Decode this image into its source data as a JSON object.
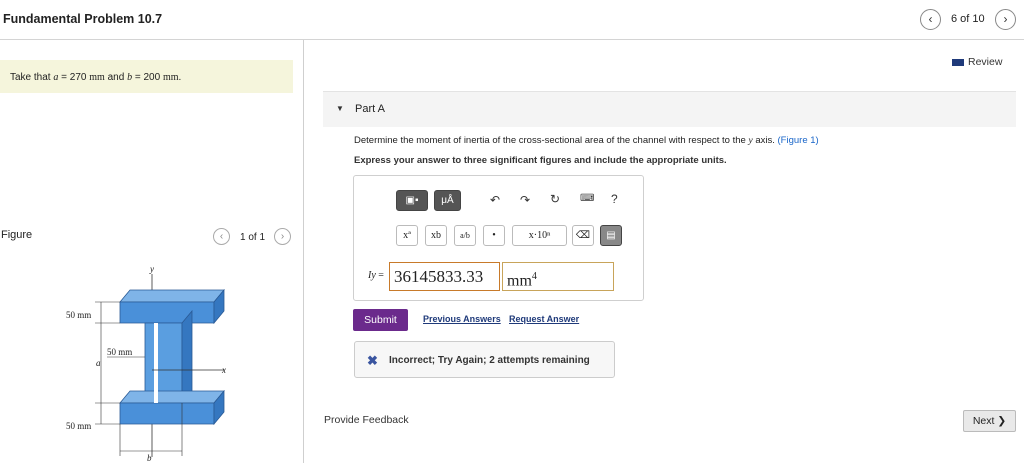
{
  "header": {
    "title": "Fundamental Problem 10.7",
    "prev_icon": "chevron-left-icon",
    "next_icon": "chevron-right-icon",
    "position": "6 of 10"
  },
  "given": {
    "text_prefix": "Take that",
    "var_a": "a",
    "equals_a": "= 270",
    "unit_a": "mm",
    "and": "and",
    "var_b": "b",
    "equals_b": "= 200",
    "unit_b": "mm",
    "end": "."
  },
  "figure": {
    "label": "Figure",
    "count": "1 of 1",
    "labels": {
      "top_dim": "50 mm",
      "mid_dim": "50 mm",
      "bottom_dim": "50 mm",
      "a": "a",
      "b": "b",
      "x": "x",
      "y": "y"
    }
  },
  "review": {
    "label": "Review",
    "icon": "book-icon"
  },
  "part": {
    "caret": "▼",
    "title": "Part A"
  },
  "question": {
    "text": "Determine the moment of inertia of the cross-sectional area of the channel with respect to the",
    "axis": "y",
    "suffix": "axis.",
    "figure_link": "(Figure 1)"
  },
  "instructions": "Express your answer to three significant figures and include the appropriate units.",
  "toolbar": {
    "templates_icon": "templates-icon",
    "units_label": "μÅ",
    "undo_icon": "undo-icon",
    "redo_icon": "redo-icon",
    "reset_icon": "reset-icon",
    "keyboard_icon": "keyboard-icon",
    "help_label": "?",
    "superscript_label": "xª",
    "subscript_label": "xb",
    "fraction_label": "a/b",
    "dot_label": "•",
    "sci_label": "x·10ⁿ",
    "delete_label": "⌫",
    "keypad_icon": "keypad-icon"
  },
  "answer": {
    "label_var": "Iy",
    "label_eq": "=",
    "value": "36145833.33",
    "unit": "mm",
    "unit_exp": "4"
  },
  "actions": {
    "submit": "Submit",
    "previous_answers": "Previous Answers",
    "request_answer": "Request Answer"
  },
  "feedback": {
    "icon": "x-icon",
    "message": "Incorrect; Try Again; 2 attempts remaining"
  },
  "footer": {
    "provide_feedback": "Provide Feedback",
    "next": "Next"
  },
  "colors": {
    "submit": "#6b2a8c",
    "link": "#1f3a7a",
    "given_bg": "#f5f5dc",
    "beam": "#4a90d9"
  }
}
